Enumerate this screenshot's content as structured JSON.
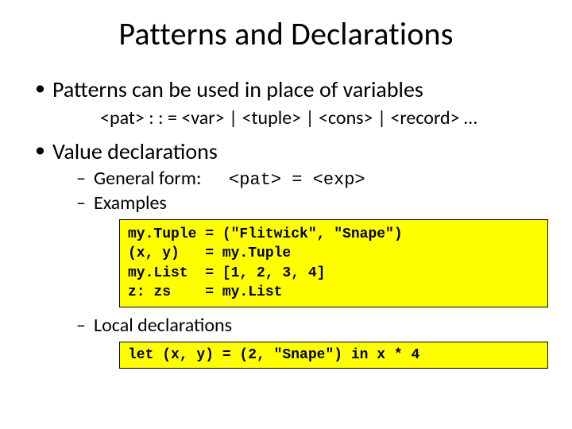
{
  "title": "Patterns and Declarations",
  "b1": "Patterns can be used in place of variables",
  "grammar": "<pat> : : = <var> | <tuple> | <cons> | <record> …",
  "b2": "Value declarations",
  "gen_form_label": "General form:",
  "gen_form_code": "<pat> = <exp>",
  "examples_label": "Examples",
  "code1": "my.Tuple = (\"Flitwick\", \"Snape\")\n(x, y)   = my.Tuple\nmy.List  = [1, 2, 3, 4]\nz: zs    = my.List",
  "local_decl_label": "Local declarations",
  "code2": "let (x, y) = (2, \"Snape\") in x * 4"
}
